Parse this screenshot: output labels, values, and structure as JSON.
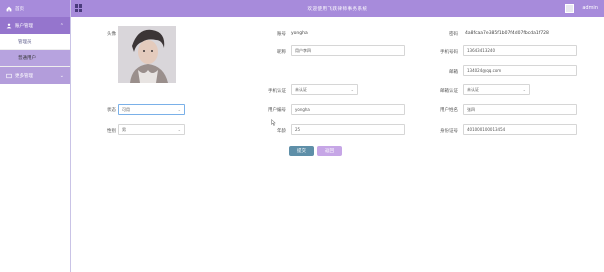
{
  "sidebar": {
    "home": "首页",
    "account_mgmt": "账户管理",
    "admin": "管理员",
    "normal_user": "普通用户",
    "more_mgmt": "更多管理"
  },
  "header": {
    "title": "欢迎使用飞跃律师事务系统",
    "user": "admin"
  },
  "form": {
    "avatar_label": "头像",
    "account_label": "账号",
    "account_value": "yongha",
    "password_label": "密码",
    "password_value": "4a8fcaa7e385f1b07f4d07fbcda1f728",
    "nickname_label": "昵称",
    "nickname_value": "用户李四",
    "phone_label": "手机号码",
    "phone_value": "13643413240",
    "email_label": "邮箱",
    "email_value": "134024@qq.com",
    "phone_verify_label": "手机认证",
    "phone_verify_value": "未认证",
    "email_verify_label": "邮箱认证",
    "email_verify_value": "未认证",
    "status_label": "状态",
    "status_value": "可用",
    "user_id_label": "用户编号",
    "user_id_value": "yongha",
    "username_label": "用户姓名",
    "username_value": "张四",
    "gender_label": "性别",
    "gender_value": "男",
    "age_label": "年龄",
    "age_value": "25",
    "idcard_label": "身份证号",
    "idcard_value": "401000100013454",
    "submit": "提交",
    "cancel": "返回"
  },
  "colors": {
    "accent": "#a78bdb",
    "submit": "#5e8fa8",
    "cancel": "#c6a6e6"
  }
}
